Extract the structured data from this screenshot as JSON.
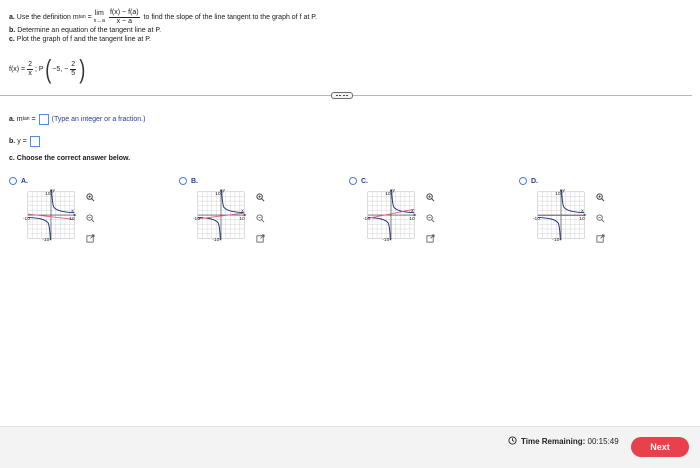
{
  "question": {
    "part_a_label": "a.",
    "part_a_prefix": "Use the definition m",
    "part_a_sub": "tan",
    "part_a_eq": "=",
    "lim_word": "lim",
    "lim_under": "x→a",
    "frac_num": "f(x) − f(a)",
    "frac_den": "x − a",
    "part_a_suffix": "to find the slope of the line tangent to the graph of f at P.",
    "part_b_label": "b.",
    "part_b_text": "Determine an equation of the tangent line at P.",
    "part_c_label": "c.",
    "part_c_text": "Plot the graph of f and the tangent line at P.",
    "fx_prefix": "f(x) =",
    "fx_num": "2",
    "fx_den": "x",
    "fx_sep": "; P",
    "point_x": "−5, −",
    "point_num": "2",
    "point_den": "5"
  },
  "answers": {
    "a_label": "a.",
    "a_m": "m",
    "a_sub": "tan",
    "a_eq": "=",
    "a_hint": "(Type an integer or a fraction.)",
    "b_label": "b.",
    "b_text": "y ="
  },
  "choose_label": "c. Choose the correct answer below.",
  "options": [
    {
      "letter": "A."
    },
    {
      "letter": "B."
    },
    {
      "letter": "C."
    },
    {
      "letter": "D."
    }
  ],
  "graph_labels": {
    "y": "y",
    "x": "x",
    "ytop": "10",
    "ybot": "-10",
    "xleft": "-10",
    "xright": "10"
  },
  "footer": {
    "timer_label": "Time Remaining:",
    "timer_value": "00:15:49",
    "next_label": "Next"
  },
  "colors": {
    "accent": "#e8414b",
    "radio": "#4a7ee0",
    "curve": "#1d2f8a",
    "tangent": "#e55a7e"
  }
}
